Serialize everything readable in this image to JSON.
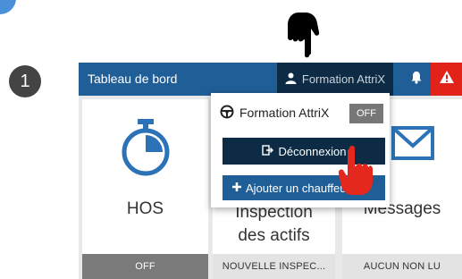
{
  "steps": {
    "main": "1"
  },
  "topbar": {
    "title": "Tableau de bord",
    "user_label": "Formation AttriX"
  },
  "dropdown": {
    "vehicle_label": "Formation AttriX",
    "toggle_label": "OFF",
    "logout_label": "Déconnexion",
    "add_driver_label": "Ajouter un chauffeur"
  },
  "tiles": [
    {
      "label": "HOS",
      "footer": "OFF"
    },
    {
      "label_line1": "Inspection",
      "label_line2": "des actifs",
      "footer": "NOUVELLE INSPEC..."
    },
    {
      "label": "Messages",
      "footer": "AUCUN NON LU"
    }
  ],
  "colors": {
    "topbar": "#1f5e96",
    "topbar_dark": "#0d2b45",
    "alert": "#e2231a",
    "hos_icon": "#2b73b6",
    "hos_footer": "#7a7a7a",
    "inactive_footer": "#e3e3e3"
  },
  "icons": [
    "user-icon",
    "bell-icon",
    "warning-icon",
    "steering-wheel-icon",
    "logout-icon",
    "plus-icon",
    "stopwatch-icon",
    "envelope-icon",
    "pointing-hand-icon"
  ]
}
